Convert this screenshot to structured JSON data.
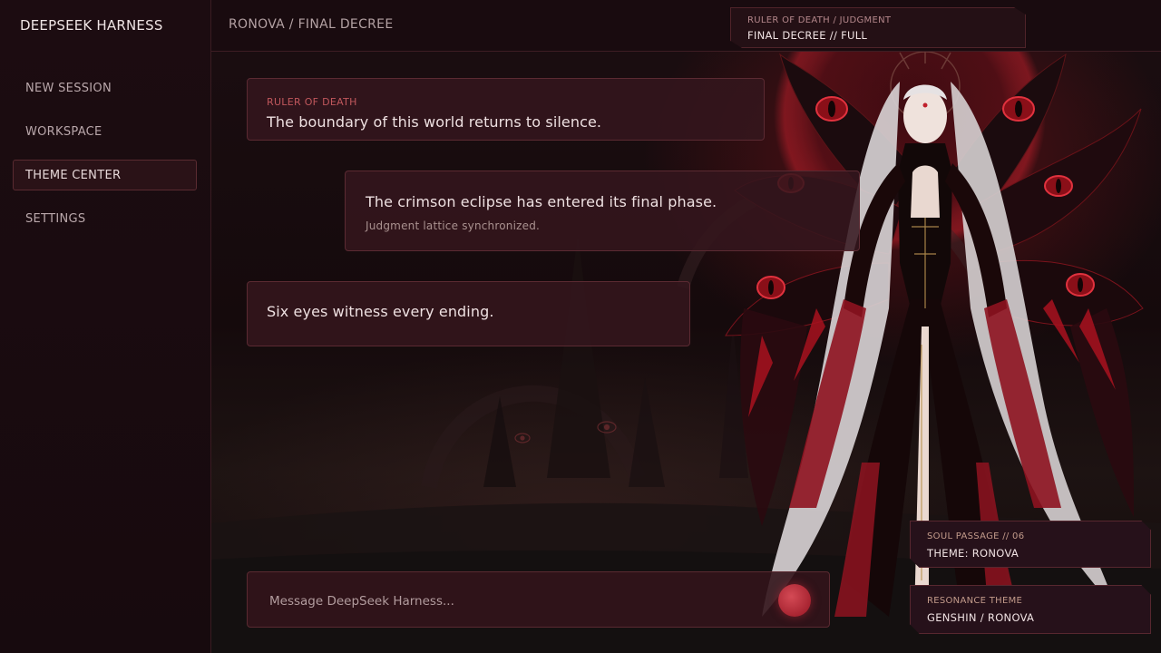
{
  "app": {
    "brand": "DEEPSEEK HARNESS"
  },
  "sidebar": {
    "items": [
      {
        "label": "NEW SESSION",
        "active": false
      },
      {
        "label": "WORKSPACE",
        "active": false
      },
      {
        "label": "THEME CENTER",
        "active": true
      },
      {
        "label": "SETTINGS",
        "active": false
      }
    ]
  },
  "header": {
    "breadcrumb": "RONOVA / FINAL DECREE",
    "decree_card": {
      "kicker": "RULER OF DEATH / JUDGMENT",
      "title": "FINAL DECREE // FULL"
    }
  },
  "messages": [
    {
      "label": "RULER OF DEATH",
      "text": "The boundary of this world returns to silence."
    },
    {
      "text": "The crimson eclipse has entered its final phase.",
      "subtext": "Judgment lattice synchronized."
    },
    {
      "text": "Six eyes witness every ending."
    }
  ],
  "composer": {
    "placeholder": "Message DeepSeek Harness...",
    "value": ""
  },
  "theme_cards": [
    {
      "kicker": "SOUL PASSAGE // 06",
      "title": "THEME: RONOVA"
    },
    {
      "kicker": "RESONANCE THEME",
      "title": "GENSHIN / RONOVA"
    }
  ],
  "colors": {
    "accent": "#c0575c",
    "send_button": "#b8303c",
    "sidebar_bg": "#1c0c11",
    "panel_border": "#5b2a32"
  },
  "icons": {
    "send": "circle-send-icon"
  }
}
